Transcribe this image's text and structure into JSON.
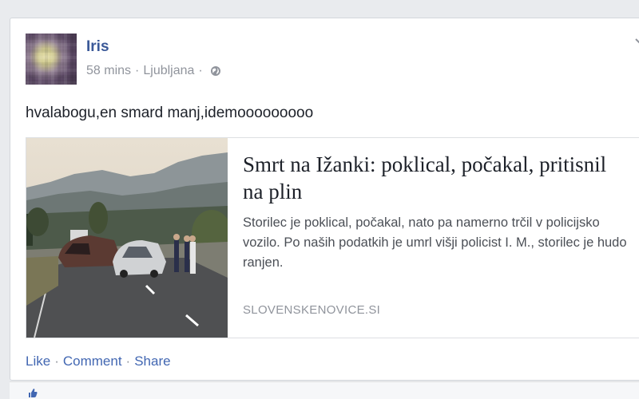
{
  "post": {
    "author": "Iris",
    "time": "58 mins",
    "separator": "·",
    "location": "Ljubljana",
    "text": "hvalabogu,en smard manj,idemooooooooo"
  },
  "link": {
    "title": "Smrt na Ižanki: poklical, počakal, pritisnil na plin",
    "description": "Storilec je poklical, počakal, nato pa namerno trčil v policijsko vozilo. Po naših podatkih je umrl višji policist I. M., storilec je hudo ranjen.",
    "domain": "SLOVENSKENOVICE.SI"
  },
  "actions": {
    "like": "Like",
    "comment": "Comment",
    "share": "Share",
    "separator": "·"
  },
  "colors": {
    "link_blue": "#3b5998",
    "action_blue": "#4267b2",
    "meta_gray": "#90949c"
  },
  "icons": {
    "privacy": "globe-icon",
    "options": "chevron-down-icon"
  }
}
